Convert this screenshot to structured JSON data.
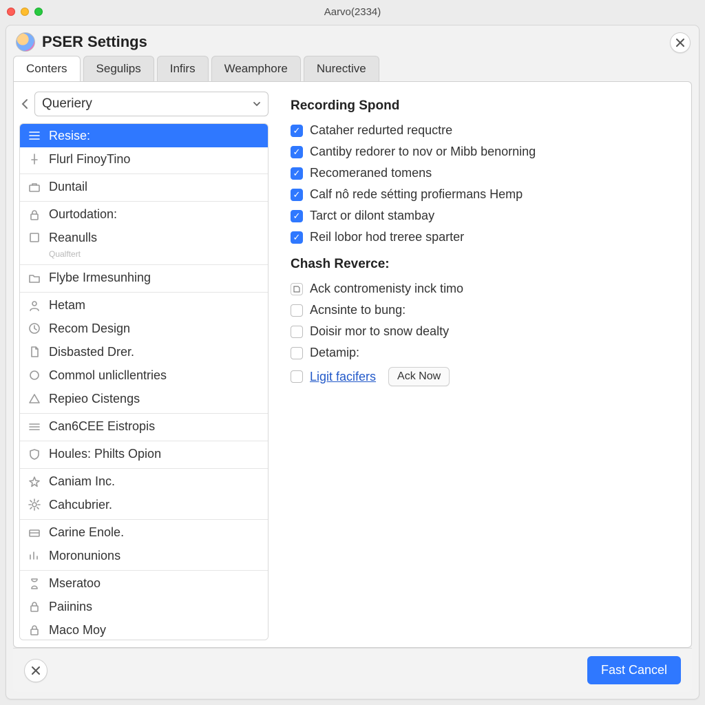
{
  "mac_title": "Aarvo(2334)",
  "window": {
    "title": "PSER Settings"
  },
  "tabs": [
    {
      "label": "Conters",
      "active": true
    },
    {
      "label": "Segulips",
      "active": false
    },
    {
      "label": "Infirs",
      "active": false
    },
    {
      "label": "Weamphore",
      "active": false
    },
    {
      "label": "Nurective",
      "active": false
    }
  ],
  "filter": {
    "value": "Queriery"
  },
  "tree": [
    {
      "icon": "menu-icon",
      "label": "Resise:",
      "selected": true
    },
    {
      "icon": "pin-icon",
      "label": "Flurl FinoyTino"
    },
    {
      "icon": "briefcase-icon",
      "label": "Duntail",
      "groupStart": true
    },
    {
      "icon": "lock-icon",
      "label": "Ourtodation:",
      "groupStart": true
    },
    {
      "icon": "square-icon",
      "label": "Reanulls",
      "subtle": "Qualftert"
    },
    {
      "icon": "folder-icon",
      "label": "Flybe Irmesunhing",
      "groupStart": true
    },
    {
      "icon": "person-icon",
      "label": "Hetam",
      "groupStart": true
    },
    {
      "icon": "clock-icon",
      "label": "Recom Design"
    },
    {
      "icon": "doc-icon",
      "label": "Disbasted Drer."
    },
    {
      "icon": "circle-icon",
      "label": "Commol unlicllentries"
    },
    {
      "icon": "triangle-icon",
      "label": "Repieo Cistengs"
    },
    {
      "icon": "bars-icon",
      "label": "Can6CEE Eistropis",
      "groupStart": true
    },
    {
      "icon": "shield-icon",
      "label": "Houles: Philts Opion",
      "groupStart": true
    },
    {
      "icon": "star-icon",
      "label": "Caniam Inc.",
      "groupStart": true
    },
    {
      "icon": "gear-icon",
      "label": "Cahcubrier."
    },
    {
      "icon": "card-icon",
      "label": "Carine Enole.",
      "groupStart": true
    },
    {
      "icon": "chart-icon",
      "label": "Moronunions"
    },
    {
      "icon": "hourglass-icon",
      "label": "Mseratoo",
      "groupStart": true
    },
    {
      "icon": "lock-icon",
      "label": "Paiinins"
    },
    {
      "icon": "lock-icon",
      "label": "Maco Moy"
    }
  ],
  "sections": {
    "recording": {
      "title": "Recording Spond",
      "options": [
        {
          "checked": true,
          "label": "Cataher redurted requctre"
        },
        {
          "checked": true,
          "label": "Cantiby redorer to nov or Mibb benorning"
        },
        {
          "checked": true,
          "label": "Recomeraned tomens"
        },
        {
          "checked": true,
          "label": "Calf nô rede sétting profiermans Hemp"
        },
        {
          "checked": true,
          "label": "Tarct or dilont stambay"
        },
        {
          "checked": true,
          "label": "Reil lobor hod treree sparter"
        }
      ]
    },
    "chash": {
      "title": "Chash Reverce:",
      "options": [
        {
          "iconBox": true,
          "label": "Ack contromenisty inck timo"
        },
        {
          "checked": false,
          "label": "Acnsinte to bung:"
        },
        {
          "checked": false,
          "label": "Doisir mor to snow dealty"
        },
        {
          "checked": false,
          "label": "Detamip:"
        },
        {
          "checked": false,
          "label": "Ligit facifers",
          "link": true,
          "trailingButton": "Ack Now"
        }
      ]
    }
  },
  "footer": {
    "primary": "Fast Cancel"
  }
}
